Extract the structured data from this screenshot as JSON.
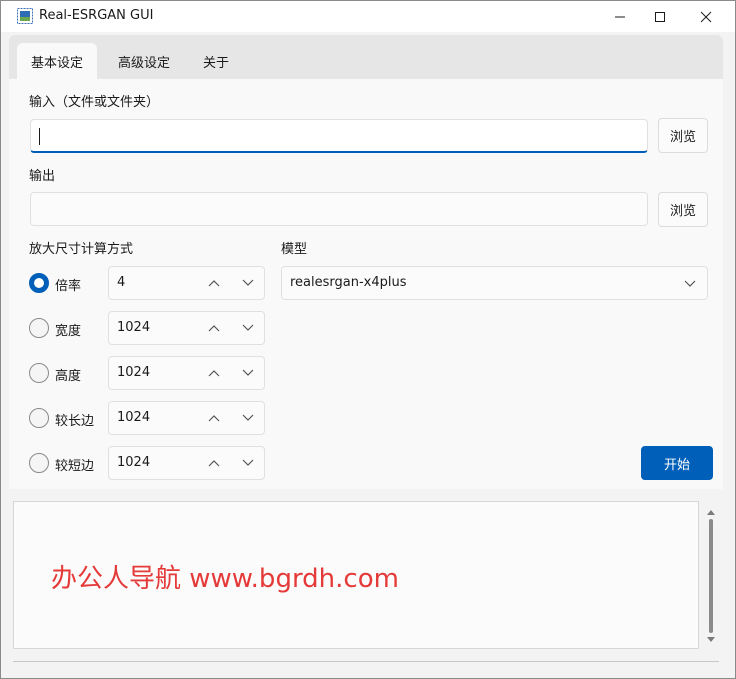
{
  "window": {
    "title": "Real-ESRGAN GUI"
  },
  "tabs": [
    {
      "label": "基本设定",
      "active": true
    },
    {
      "label": "高级设定",
      "active": false
    },
    {
      "label": "关于",
      "active": false
    }
  ],
  "input": {
    "label": "输入（文件或文件夹）",
    "value": "",
    "browse_label": "浏览"
  },
  "output": {
    "label": "输出",
    "value": "",
    "browse_label": "浏览"
  },
  "scale": {
    "label": "放大尺寸计算方式",
    "options": [
      {
        "label": "倍率",
        "value": "4",
        "checked": true
      },
      {
        "label": "宽度",
        "value": "1024",
        "checked": false
      },
      {
        "label": "高度",
        "value": "1024",
        "checked": false
      },
      {
        "label": "较长边",
        "value": "1024",
        "checked": false
      },
      {
        "label": "较短边",
        "value": "1024",
        "checked": false
      }
    ]
  },
  "model": {
    "label": "模型",
    "selected": "realesrgan-x4plus"
  },
  "start_label": "开始",
  "log": {
    "watermark": "办公人导航 www.bgrdh.com"
  },
  "colors": {
    "accent": "#005fb8",
    "watermark": "#e53a3a"
  }
}
